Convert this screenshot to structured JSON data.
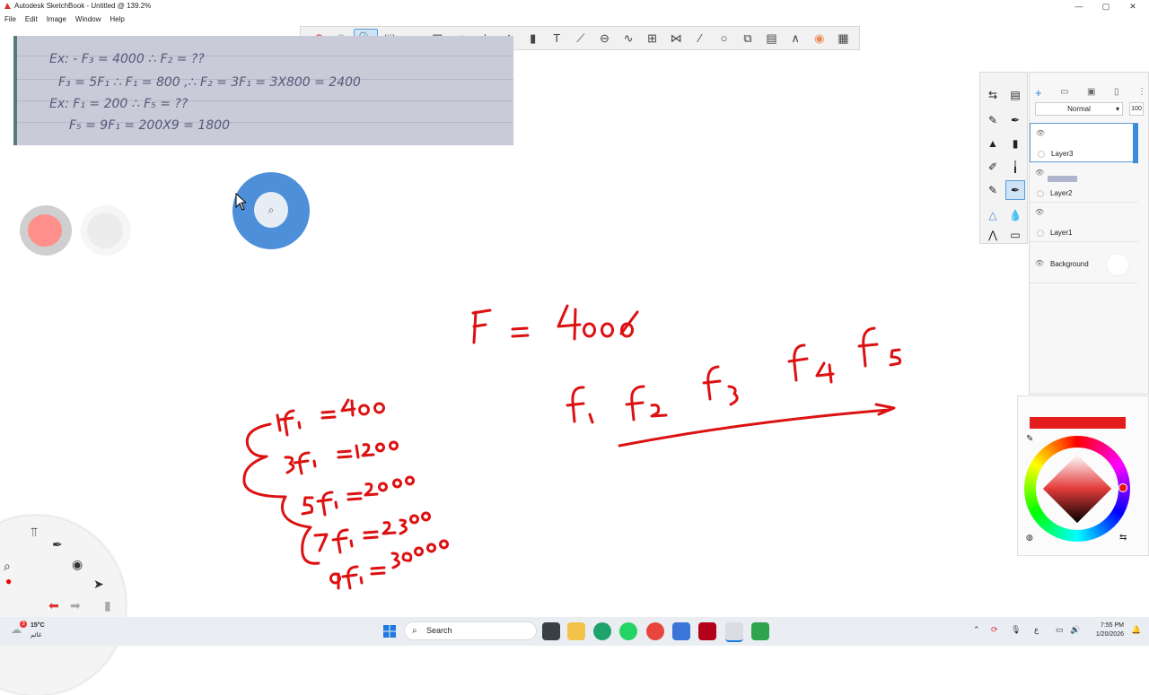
{
  "window": {
    "title": "Autodesk SketchBook - Untitled @ 139.2%",
    "controls": [
      "—",
      "▢",
      "✕"
    ]
  },
  "menu": {
    "items": [
      "File",
      "Edit",
      "Image",
      "Window",
      "Help"
    ]
  },
  "toolbar": {
    "tools": [
      {
        "name": "undo-icon",
        "glyph": "↶"
      },
      {
        "name": "redo-icon",
        "glyph": "↷"
      },
      {
        "name": "zoom-icon",
        "glyph": "🔍"
      },
      {
        "name": "select-icon",
        "glyph": "⬚"
      },
      {
        "name": "lasso-select-icon",
        "glyph": "◌"
      },
      {
        "name": "magic-select-icon",
        "glyph": "▨"
      },
      {
        "name": "crop-icon",
        "glyph": "⌗"
      },
      {
        "name": "transform-icon",
        "glyph": "⊹"
      },
      {
        "name": "distort-icon",
        "glyph": "◇"
      },
      {
        "name": "fill-icon",
        "glyph": "▮"
      },
      {
        "name": "text-icon",
        "glyph": "T"
      },
      {
        "name": "ruler-icon",
        "glyph": "⟋"
      },
      {
        "name": "ellipse-guide-icon",
        "glyph": "⊖"
      },
      {
        "name": "french-curve-icon",
        "glyph": "∿"
      },
      {
        "name": "perspective-icon",
        "glyph": "⊞"
      },
      {
        "name": "symmetry-icon",
        "glyph": "⋈"
      },
      {
        "name": "line-icon",
        "glyph": "⁄"
      },
      {
        "name": "circle-icon",
        "glyph": "○"
      },
      {
        "name": "shapes-icon",
        "glyph": "⧉"
      },
      {
        "name": "layer-editor-icon",
        "glyph": "▤"
      },
      {
        "name": "brush-palette-icon",
        "glyph": "∧"
      },
      {
        "name": "color-wheel-icon",
        "glyph": "◉"
      },
      {
        "name": "copic-library-icon",
        "glyph": "▦"
      }
    ]
  },
  "reference": {
    "rows": [
      "Ex: - F₃ = 4000    ∴ F₂ = ??",
      "F₃ = 5F₁   ∴ F₁ = 800   ,∴ F₂ = 3F₁ = 3X800 = 2400",
      "Ex: F₁ = 200    ∴ F₅ = ??",
      "F₅ = 9F₁ = 200X9 = 1800"
    ]
  },
  "layers": {
    "blend_mode": "Normal",
    "opacity": "100",
    "items": [
      {
        "name": "Layer3"
      },
      {
        "name": "Layer2"
      },
      {
        "name": "Layer1"
      },
      {
        "name": "Background"
      }
    ]
  },
  "colors": {
    "current": "#e41c1c",
    "puck_color": "#ff8f8a",
    "wheel_marker": "#ee1111",
    "ink": "#dd1111"
  },
  "taskbar": {
    "search_placeholder": "Search",
    "weather_temp": "15°C",
    "weather_desc": "غائم",
    "weather_badge": "3",
    "time": "7:55 PM",
    "date": "1/20/2026",
    "lang": "ع"
  }
}
